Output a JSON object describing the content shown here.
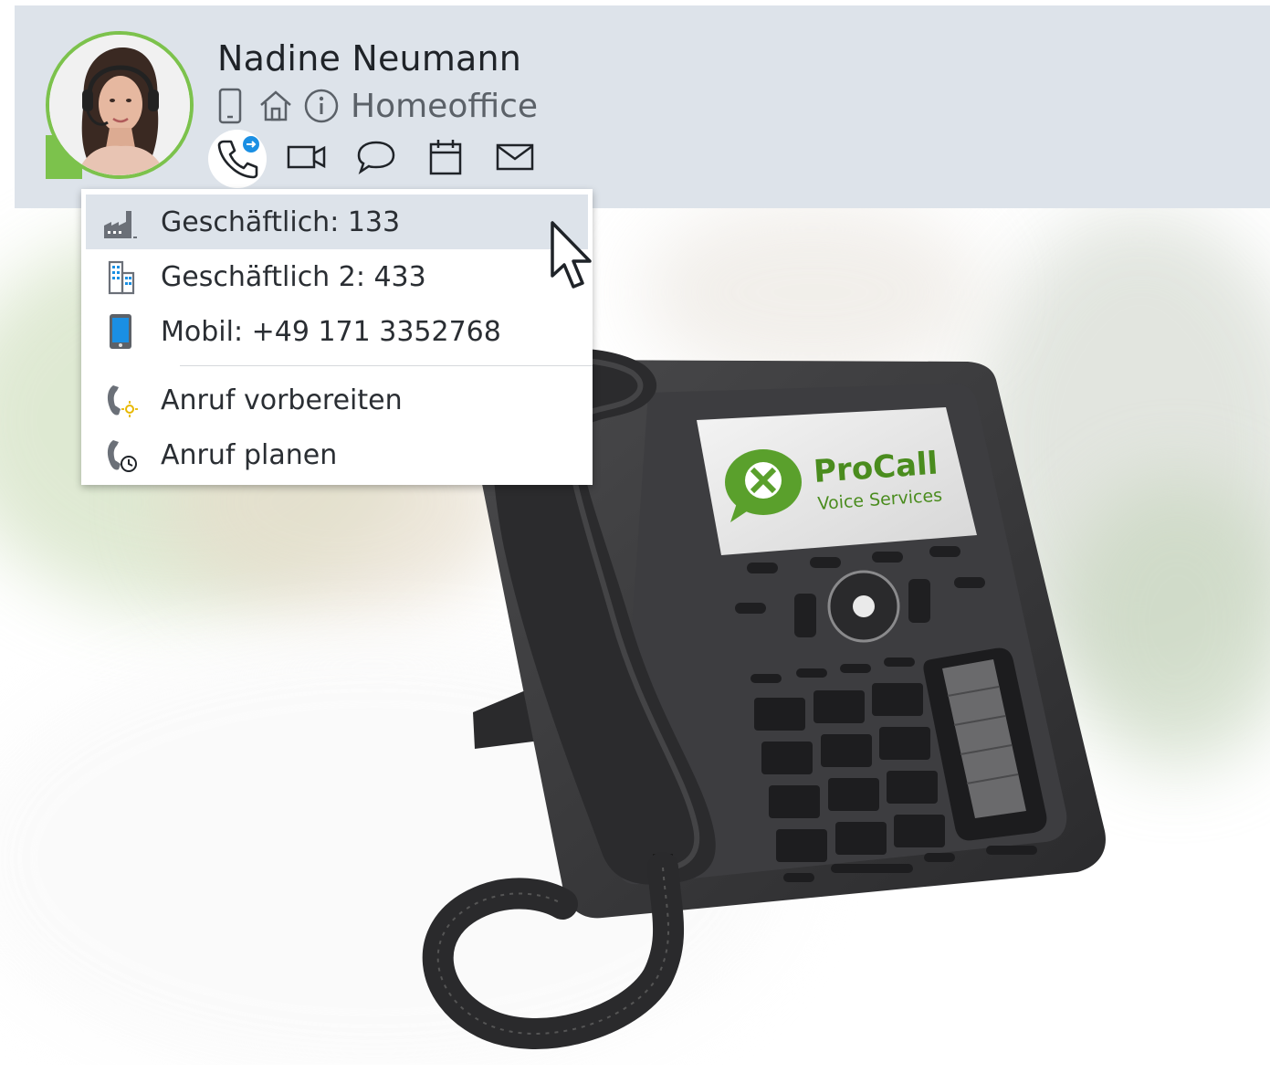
{
  "contact": {
    "name": "Nadine Neumann",
    "status_text": "Homeoffice",
    "presence_color": "#7cc24c",
    "status_icons": [
      "mobile-phone-icon",
      "home-icon",
      "info-icon"
    ]
  },
  "actions": [
    {
      "name": "call",
      "icon": "phone-forward-icon",
      "active": true
    },
    {
      "name": "video",
      "icon": "video-camera-icon",
      "active": false
    },
    {
      "name": "chat",
      "icon": "chat-bubble-icon",
      "active": false
    },
    {
      "name": "calendar",
      "icon": "calendar-icon",
      "active": false
    },
    {
      "name": "email",
      "icon": "envelope-icon",
      "active": false
    }
  ],
  "menu": {
    "items": [
      {
        "label": "Geschäftlich: 133",
        "icon": "factory-icon",
        "hover": true
      },
      {
        "label": "Geschäftlich 2: 433",
        "icon": "office-building-icon",
        "hover": false
      },
      {
        "label": "Mobil: +49 171 3352768",
        "icon": "smartphone-icon",
        "hover": false
      },
      {
        "label": "Anruf vorbereiten",
        "icon": "phone-prepare-icon",
        "hover": false
      },
      {
        "label": "Anruf planen",
        "icon": "phone-schedule-icon",
        "hover": false
      }
    ]
  },
  "phone_screen": {
    "brand": "ProCall",
    "tagline": "Voice Services"
  },
  "colors": {
    "header_bg": "#dde3ea",
    "accent_blue": "#1a8fe3",
    "brand_green": "#5aa02c"
  }
}
